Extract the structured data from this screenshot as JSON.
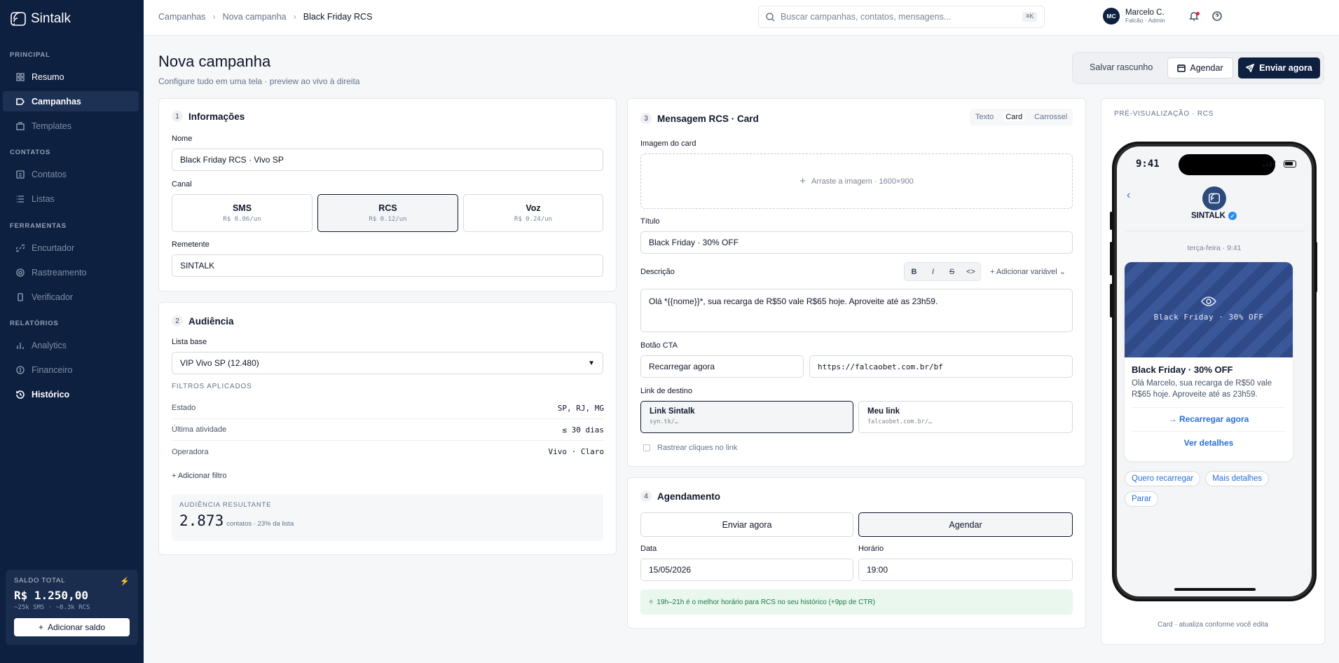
{
  "app": {
    "name": "Sintalk"
  },
  "sidebar": {
    "sections": [
      {
        "title": "PRINCIPAL",
        "items": [
          {
            "label": "Resumo"
          },
          {
            "label": "Campanhas",
            "active": true
          },
          {
            "label": "Templates"
          }
        ]
      },
      {
        "title": "CONTATOS",
        "items": [
          {
            "label": "Contatos"
          },
          {
            "label": "Listas"
          }
        ]
      },
      {
        "title": "FERRAMENTAS",
        "items": [
          {
            "label": "Encurtador"
          },
          {
            "label": "Rastreamento"
          },
          {
            "label": "Verificador"
          }
        ]
      },
      {
        "title": "RELATÓRIOS",
        "items": [
          {
            "label": "Analytics"
          },
          {
            "label": "Financeiro"
          },
          {
            "label": "Histórico"
          }
        ]
      }
    ],
    "balance": {
      "label": "SALDO TOTAL",
      "amount": "R$ 1.250,00",
      "detail": "~25k SMS · ~8.3k RCS",
      "add_label": "Adicionar saldo"
    }
  },
  "header": {
    "breadcrumbs": [
      "Campanhas",
      "Nova campanha",
      "Black Friday RCS"
    ],
    "search_placeholder": "Buscar campanhas, contatos, mensagens...",
    "search_shortcut": "⌘K",
    "user": {
      "initials": "MC",
      "name": "Marcelo C.",
      "role": "Falcão · Admin"
    }
  },
  "page": {
    "title": "Nova campanha",
    "subtitle": "Configure tudo em uma tela · preview ao vivo à direita",
    "actions": {
      "draft": "Salvar rascunho",
      "schedule": "Agendar",
      "send": "Enviar agora"
    }
  },
  "info": {
    "num": "1",
    "title": "Informações",
    "name_label": "Nome",
    "name_value": "Black Friday RCS · Vivo SP",
    "channel_label": "Canal",
    "channels": [
      {
        "name": "SMS",
        "price": "R$ 0.06/un"
      },
      {
        "name": "RCS",
        "price": "R$ 0.12/un",
        "selected": true
      },
      {
        "name": "Voz",
        "price": "R$ 0.24/un"
      }
    ],
    "sender_label": "Remetente",
    "sender_value": "SINTALK"
  },
  "audience": {
    "num": "2",
    "title": "Audiência",
    "list_label": "Lista base",
    "list_value": "VIP Vivo SP (12.480)",
    "filters_label": "FILTROS APLICADOS",
    "filters": [
      {
        "name": "Estado",
        "value": "SP, RJ, MG"
      },
      {
        "name": "Última atividade",
        "value": "≤ 30 dias"
      },
      {
        "name": "Operadora",
        "value": "Vivo · Claro"
      }
    ],
    "add_filter": "+ Adicionar filtro",
    "result_label": "AUDIÊNCIA RESULTANTE",
    "result_value": "2.873",
    "result_detail": "contatos · 23% da lista"
  },
  "message": {
    "num": "3",
    "title": "Mensagem RCS · Card",
    "tabs": [
      {
        "label": "Texto"
      },
      {
        "label": "Card",
        "active": true
      },
      {
        "label": "Carrossel"
      }
    ],
    "image_label": "Imagem do card",
    "image_drop": "Arraste a imagem · 1600×900",
    "title_label": "Título",
    "title_value": "Black Friday · 30% OFF",
    "desc_label": "Descrição",
    "format": {
      "bold": "B",
      "italic": "I",
      "strike": "S",
      "code": "<>"
    },
    "add_variable": "Adicionar variável",
    "desc_value": "Olá *{{nome}}*, sua recarga de R$50 vale R$65 hoje. Aproveite até as 23h59.",
    "cta_label": "Botão CTA",
    "cta_text": "Recarregar agora",
    "cta_url": "https://falcaobet.com.br/bf",
    "link_label": "Link de destino",
    "links": [
      {
        "name": "Link Sintalk",
        "url": "syn.tk/…",
        "selected": true
      },
      {
        "name": "Meu link",
        "url": "falcaobet.com.br/…"
      }
    ],
    "track_label": "Rastrear cliques no link"
  },
  "schedule": {
    "num": "4",
    "title": "Agendamento",
    "options": [
      {
        "label": "Enviar agora"
      },
      {
        "label": "Agendar",
        "selected": true
      }
    ],
    "date_label": "Data",
    "date_value": "15/05/2026",
    "time_label": "Horário",
    "time_value": "19:00",
    "tip": "19h–21h é o melhor horário para RCS no seu histórico (+9pp de CTR)"
  },
  "preview": {
    "label": "PRÉ-VISUALIZAÇÃO · RCS",
    "clock": "9:41",
    "brand": "SINTALK",
    "day": "terça-feira · 9:41",
    "card_image_caption": "Black Friday · 30% OFF",
    "card_title": "Black Friday · 30% OFF",
    "card_desc": "Olá Marcelo, sua recarga de R$50 vale R$65 hoje. Aproveite até as 23h59.",
    "cta": "→ Recarregar agora",
    "details": "Ver detalhes",
    "chips": [
      "Quero recarregar",
      "Mais detalhes",
      "Parar"
    ],
    "footer": "Card · atualiza conforme você edita"
  },
  "colors": {
    "sidebar": "#0e2040",
    "accent": "#2a6fd6",
    "primary_button": "#0e2040",
    "tip_bg": "#e9f7ee"
  }
}
